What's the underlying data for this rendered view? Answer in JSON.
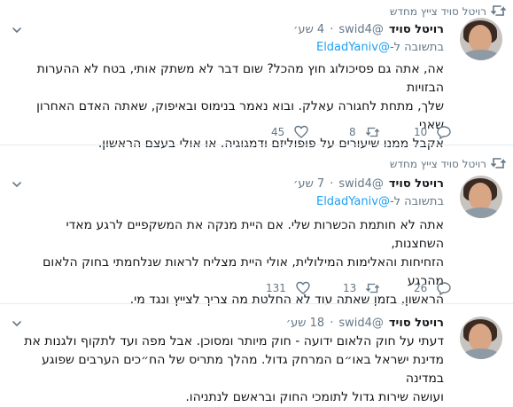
{
  "tweets": [
    {
      "retweet_label": "רויטל סויד צייץ מחדש",
      "name": "רויטל סויד",
      "handle": "@swid4",
      "time": "4 שע׳",
      "reply_prefix": "בתשובה ל-",
      "reply_to": "@EldadYaniv",
      "lines": [
        "אה, אתה גם פסיכולוג חוץ מהכל? שום דבר לא משתק אותי, בטח לא ההערות הבזויות",
        "שלך, מתחת לחגורה עאלק. ובוא נאמר בנימוס ובאיפוק, שאתה האדם האחרון שאני",
        "אקבל ממנו שיעורים על פופוליזם ודמגוגיה. או אולי בעצם הראשון."
      ],
      "replies": "10",
      "retweets": "8",
      "likes": "45"
    },
    {
      "retweet_label": "רויטל סויד צייץ מחדש",
      "name": "רויטל סויד",
      "handle": "@swid4",
      "time": "7 שע׳",
      "reply_prefix": "בתשובה ל-",
      "reply_to": "@EldadYaniv",
      "lines": [
        "אתה לא חותמת הכשרות שלי. אם היית מנקה את המשקפיים לרגע מאדי השחצנות,",
        "הזחיחות והאלימות המילולית, אולי היית מצליח לראות שנלחמתי בחוק הלאום מהרגע",
        "הראשון, בזמן שאתה עוד לא החלטת מה צריך לצייץ ונגד מי."
      ],
      "replies": "26",
      "retweets": "13",
      "likes": "131"
    },
    {
      "name": "רויטל סויד",
      "handle": "@swid4",
      "time": "18 שע׳",
      "lines": [
        "דעתי על חוק הלאום ידועה - חוק מיותר ומסוכן. אבל מפה ועד לתקוף ולגנות את",
        "מדינת ישראל באו״ם המרחק גדול. מהלך מתריס של הח״כים הערבים שפוגע במדינה",
        "ועושה שירות גדול לתומכי החוק ובראשם לנתניהו."
      ]
    }
  ],
  "icons": {
    "retweet": "retweet-icon",
    "reply": "reply-icon",
    "like": "heart-icon",
    "more": "chevron-down-icon",
    "avatar": "avatar"
  },
  "colors": {
    "link": "#1da1f2",
    "muted": "#657786",
    "text": "#14171a",
    "separator": "#e6ecf0"
  }
}
